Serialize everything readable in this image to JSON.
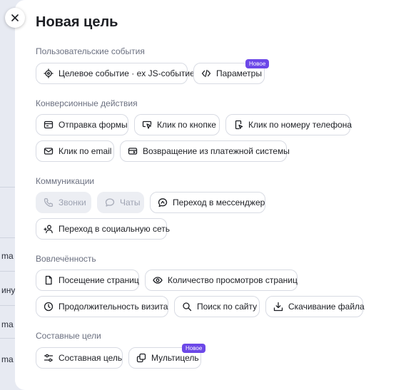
{
  "background": {
    "texts": [
      "ma",
      "ину",
      "ma",
      "ma"
    ]
  },
  "modal": {
    "title": "Новая цель",
    "close_icon": "close-icon",
    "new_badge": "Новое"
  },
  "sections": {
    "user_events": {
      "title": "Пользовательские события",
      "items": [
        {
          "label": "Целевое событие · ex JS-событие",
          "icon": "target-icon"
        },
        {
          "label": "Параметры",
          "icon": "code-icon",
          "badge": "Новое"
        }
      ]
    },
    "conversions": {
      "title": "Конверсионные действия",
      "items": [
        {
          "label": "Отправка формы",
          "icon": "form-icon"
        },
        {
          "label": "Клик по кнопке",
          "icon": "click-icon"
        },
        {
          "label": "Клик по номеру телефона",
          "icon": "phone-click-icon"
        },
        {
          "label": "Клик по email",
          "icon": "email-icon"
        },
        {
          "label": "Возвращение из платежной системы",
          "icon": "payment-icon"
        }
      ]
    },
    "communications": {
      "title": "Коммуникации",
      "items": [
        {
          "label": "Звонки",
          "icon": "phone-icon",
          "disabled": true
        },
        {
          "label": "Чаты",
          "icon": "chat-icon",
          "disabled": true
        },
        {
          "label": "Переход в мессенджер",
          "icon": "messenger-icon"
        },
        {
          "label": "Переход в социальную сеть",
          "icon": "social-icon"
        }
      ]
    },
    "engagement": {
      "title": "Вовлечённость",
      "items": [
        {
          "label": "Посещение страниц",
          "icon": "page-icon"
        },
        {
          "label": "Количество просмотров страниц",
          "icon": "eye-icon"
        },
        {
          "label": "Продолжительность визита",
          "icon": "clock-icon"
        },
        {
          "label": "Поиск по сайту",
          "icon": "search-icon"
        },
        {
          "label": "Скачивание файла",
          "icon": "download-icon"
        }
      ]
    },
    "composite": {
      "title": "Составные цели",
      "items": [
        {
          "label": "Составная цель",
          "icon": "sliders-icon"
        },
        {
          "label": "Мультицель",
          "icon": "multigoal-icon",
          "badge": "Новое"
        }
      ]
    }
  }
}
